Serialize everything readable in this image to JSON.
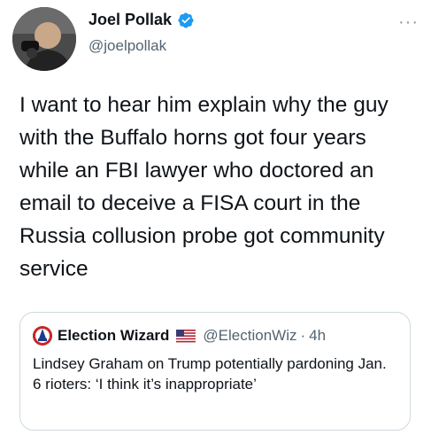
{
  "author": {
    "display_name": "Joel Pollak",
    "handle": "@joelpollak",
    "verified_icon": "verified-badge-icon",
    "avatar_icon": "profile-photo"
  },
  "more_icon": "more-dots-icon",
  "more_label": "···",
  "tweet_text": "I want to hear him explain why the guy with the Buffalo horns got four years while an FBI lawyer who doctored an email to deceive a FISA court in the Russia collusion probe got community service",
  "quoted_tweet": {
    "display_name": "Election Wizard",
    "flag_icon": "us-flag-icon",
    "handle": "@ElectionWiz",
    "separator": "·",
    "time": "4h",
    "text": "Lindsey Graham on Trump potentially pardoning Jan. 6 rioters: ‘I think it’s inappropriate’"
  },
  "colors": {
    "verified_blue": "#1d9bf0",
    "secondary_text": "#536471",
    "border": "#cfd9de",
    "quote_avatar_red": "#c62828"
  }
}
